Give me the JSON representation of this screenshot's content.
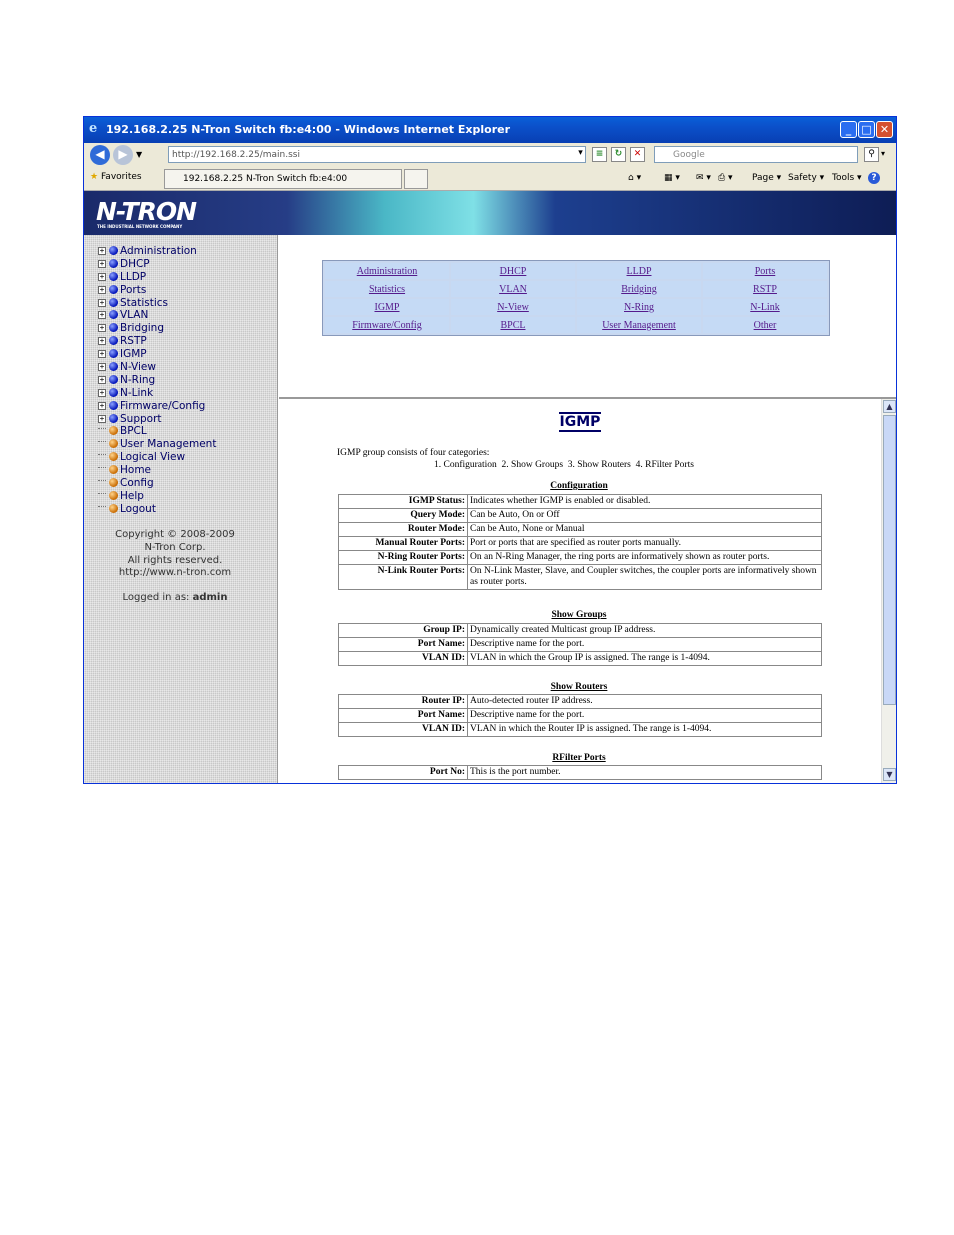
{
  "window": {
    "title": "192.168.2.25 N-Tron Switch fb:e4:00 - Windows Internet Explorer",
    "minimize": "_",
    "maximize": "□",
    "close": "✕"
  },
  "browser": {
    "address": "http://192.168.2.25/main.ssi",
    "search_placeholder": "Google",
    "favorites_label": "Favorites",
    "tab_title": "192.168.2.25 N-Tron Switch fb:e4:00",
    "commands": {
      "page": "Page ▾",
      "safety": "Safety ▾",
      "tools": "Tools ▾",
      "help": "?"
    }
  },
  "banner": {
    "logo": "N-TRON",
    "tagline": "THE INDUSTRIAL NETWORK COMPANY"
  },
  "sidebar": {
    "items": [
      {
        "label": "Administration",
        "expandable": true,
        "dot": "blue"
      },
      {
        "label": "DHCP",
        "expandable": true,
        "dot": "blue"
      },
      {
        "label": "LLDP",
        "expandable": true,
        "dot": "blue"
      },
      {
        "label": "Ports",
        "expandable": true,
        "dot": "blue"
      },
      {
        "label": "Statistics",
        "expandable": true,
        "dot": "blue"
      },
      {
        "label": "VLAN",
        "expandable": true,
        "dot": "blue"
      },
      {
        "label": "Bridging",
        "expandable": true,
        "dot": "blue"
      },
      {
        "label": "RSTP",
        "expandable": true,
        "dot": "blue"
      },
      {
        "label": "IGMP",
        "expandable": true,
        "dot": "blue"
      },
      {
        "label": "N-View",
        "expandable": true,
        "dot": "blue"
      },
      {
        "label": "N-Ring",
        "expandable": true,
        "dot": "blue"
      },
      {
        "label": "N-Link",
        "expandable": true,
        "dot": "blue"
      },
      {
        "label": "Firmware/Config",
        "expandable": true,
        "dot": "blue"
      },
      {
        "label": "Support",
        "expandable": true,
        "dot": "blue"
      },
      {
        "label": "BPCL",
        "expandable": false,
        "dot": "orange"
      },
      {
        "label": "User Management",
        "expandable": false,
        "dot": "orange"
      },
      {
        "label": "Logical View",
        "expandable": false,
        "dot": "orange"
      },
      {
        "label": "Home",
        "expandable": false,
        "dot": "orange"
      },
      {
        "label": "Config",
        "expandable": false,
        "dot": "orange"
      },
      {
        "label": "Help",
        "expandable": false,
        "dot": "orange"
      },
      {
        "label": "Logout",
        "expandable": false,
        "dot": "orange"
      }
    ],
    "copyright": [
      "Copyright © 2008-2009",
      "N-Tron Corp.",
      "All rights reserved.",
      "http://www.n-tron.com"
    ],
    "logged_in_prefix": "Logged in as:",
    "logged_in_user": "admin"
  },
  "nav_grid": [
    [
      "Administration",
      "DHCP",
      "LLDP",
      "Ports"
    ],
    [
      "Statistics",
      "VLAN",
      "Bridging",
      "RSTP"
    ],
    [
      "IGMP",
      "N-View",
      "N-Ring",
      "N-Link"
    ],
    [
      "Firmware/Config",
      "BPCL",
      "User Management",
      "Other"
    ]
  ],
  "help_page": {
    "title": "IGMP",
    "intro": "IGMP group consists of four categories:",
    "categories": "1. Configuration  2. Show Groups  3. Show Routers  4. RFilter Ports",
    "sections": [
      {
        "heading": "Configuration",
        "rows": [
          {
            "key": "IGMP Status:",
            "value": "Indicates whether IGMP is enabled or disabled."
          },
          {
            "key": "Query Mode:",
            "value": "Can be Auto, On or Off"
          },
          {
            "key": "Router Mode:",
            "value": "Can be Auto, None or Manual"
          },
          {
            "key": "Manual Router Ports:",
            "value": "Port or ports that are specified as router ports manually."
          },
          {
            "key": "N-Ring Router Ports:",
            "value": "On an N-Ring Manager, the ring ports are informatively shown as router ports."
          },
          {
            "key": "N-Link Router Ports:",
            "value": "On N-Link Master, Slave, and Coupler switches, the coupler ports are informatively shown as router ports."
          }
        ]
      },
      {
        "heading": "Show Groups",
        "rows": [
          {
            "key": "Group IP:",
            "value": "Dynamically created Multicast group IP address."
          },
          {
            "key": "Port Name:",
            "value": "Descriptive name for the port."
          },
          {
            "key": "VLAN ID:",
            "value": "VLAN in which the Group IP is assigned. The range is 1-4094."
          }
        ]
      },
      {
        "heading": "Show Routers",
        "rows": [
          {
            "key": "Router IP:",
            "value": "Auto-detected router IP address."
          },
          {
            "key": "Port Name:",
            "value": "Descriptive name for the port."
          },
          {
            "key": "VLAN ID:",
            "value": "VLAN in which the Router IP is assigned. The range is 1-4094."
          }
        ]
      },
      {
        "heading": "RFilter Ports",
        "rows": [
          {
            "key": "Port No:",
            "value": "This is the port number."
          }
        ]
      }
    ]
  }
}
